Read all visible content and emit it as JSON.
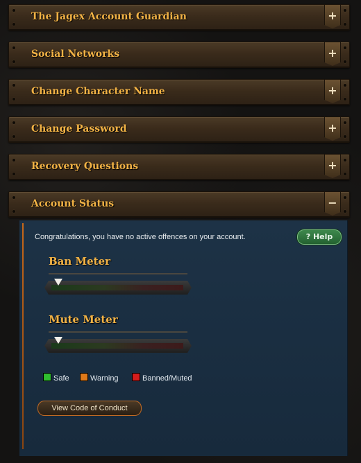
{
  "sections": [
    {
      "label": "The Jagex Account Guardian",
      "toggle": "+"
    },
    {
      "label": "Social Networks",
      "toggle": "+"
    },
    {
      "label": "Change Character Name",
      "toggle": "+"
    },
    {
      "label": "Change Password",
      "toggle": "+"
    },
    {
      "label": "Recovery Questions",
      "toggle": "+"
    },
    {
      "label": "Account Status",
      "toggle": "−"
    }
  ],
  "account_status": {
    "message": "Congratulations, you have no active offences on your account.",
    "help_label": "? Help",
    "ban_meter": {
      "title": "Ban Meter",
      "level": 0
    },
    "mute_meter": {
      "title": "Mute Meter",
      "level": 0
    },
    "legend": [
      {
        "label": "Safe",
        "color": "#2fbf2f"
      },
      {
        "label": "Warning",
        "color": "#e07a1a"
      },
      {
        "label": "Banned/Muted",
        "color": "#d41c1c"
      }
    ],
    "code_of_conduct_label": "View Code of Conduct"
  }
}
